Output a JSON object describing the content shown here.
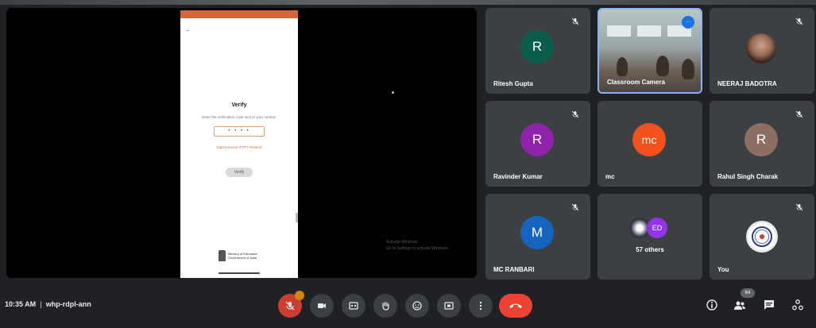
{
  "presentation": {
    "screen_title": "Verify",
    "screen_subtitle": "Enter the verification code sent to your number",
    "otp_value": "• • • •",
    "resend_label": "Didn't receive OTP? Resend",
    "verify_button": "Verify",
    "back_glyph": "←",
    "emblem_caption": "Ministry of Education Government of India",
    "watermark_line1": "Activate Windows",
    "watermark_line2": "Go to Settings to activate Windows."
  },
  "tiles": [
    {
      "name": "Ritesh Gupta",
      "initial": "R",
      "color": "#0b5e4b"
    },
    {
      "name": "Classroom Camera",
      "badge": "⋯"
    },
    {
      "name": "NEERAJ BADOTRA"
    },
    {
      "name": "Ravinder Kumar",
      "initial": "R",
      "color": "#8e24aa"
    },
    {
      "name": "mc",
      "initial": "mc",
      "color": "#f4511e"
    },
    {
      "name": "Rahul Singh Charak",
      "initial": "R",
      "color": "#8d6e63"
    },
    {
      "name": "MC RANBARI",
      "initial": "M",
      "color": "#1565c0"
    },
    {
      "name": "57 others",
      "second_initials": "ED"
    },
    {
      "name": "You"
    }
  ],
  "bottom_bar": {
    "time": "10:35 AM",
    "meeting_code": "whp-rdpl-ann",
    "people_count": "64"
  },
  "colors": {
    "background": "#202124",
    "tile": "#3c4043",
    "end_call": "#ea4335",
    "accent": "#8ab4f8"
  },
  "icons": [
    "mic-off-icon",
    "camera-icon",
    "captions-icon",
    "raise-hand-icon",
    "emoji-icon",
    "present-icon",
    "more-options-icon",
    "end-call-icon",
    "info-icon",
    "people-icon",
    "chat-icon",
    "activities-icon",
    "pin-icon"
  ]
}
